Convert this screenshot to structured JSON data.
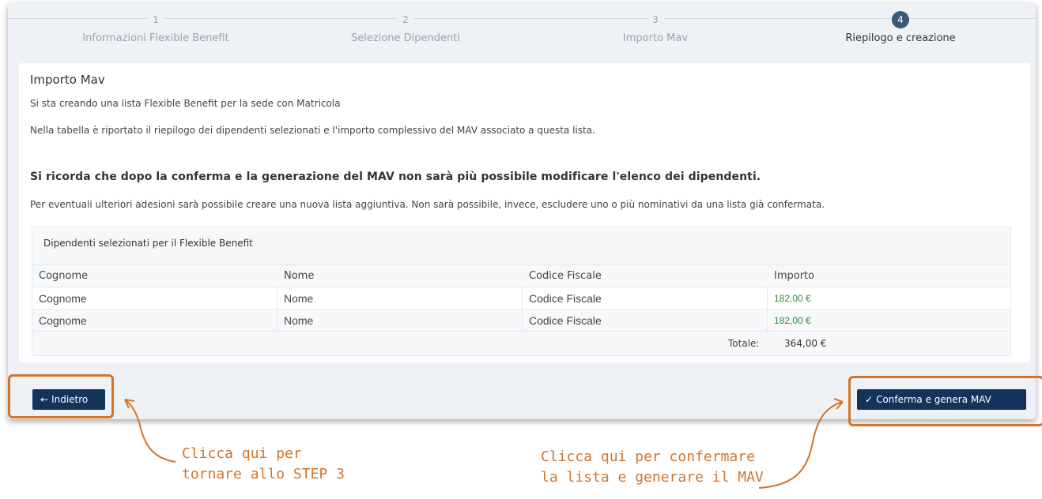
{
  "stepper": {
    "steps": [
      {
        "number": "1",
        "label": "Informazioni Flexible Benefit"
      },
      {
        "number": "2",
        "label": "Selezione Dipendenti"
      },
      {
        "number": "3",
        "label": "Importo Mav"
      },
      {
        "number": "4",
        "label": "Riepilogo e creazione"
      }
    ],
    "active_step": 4
  },
  "card": {
    "title": "Importo Mav",
    "intro": "Si sta creando una lista Flexible Benefit per la sede con Matricola",
    "description": "Nella tabella è riportato il riepilogo dei dipendenti selezionati e l'importo complessivo del MAV associato a questa lista.",
    "warning": "Si ricorda che dopo la conferma e la generazione del MAV non sarà più possibile modificare l'elenco dei dipendenti.",
    "note": "Per eventuali ulteriori adesioni sarà possibile creare una nuova lista aggiuntiva. Non sarà possibile, invece, escludere uno o più nominativi da una lista già confermata."
  },
  "table": {
    "caption": "Dipendenti selezionati per il Flexible Benefit",
    "columns": [
      "Cognome",
      "Nome",
      "Codice Fiscale",
      "Importo"
    ],
    "rows": [
      [
        "Cognome",
        "Nome",
        "Codice Fiscale",
        "182,00 €"
      ],
      [
        "Cognome",
        "Nome",
        "Codice Fiscale",
        "182,00 €"
      ]
    ],
    "total_label": "Totale:",
    "total_value": "364,00 €"
  },
  "actions": {
    "back_label": "Indietro",
    "confirm_label": "Conferma e genera MAV"
  },
  "annotations": {
    "back_note_line1": "Clicca qui per",
    "back_note_line2": "tornare allo STEP 3",
    "confirm_note_line1": "Clicca qui per confermare",
    "confirm_note_line2": "la lista e generare il MAV"
  },
  "colors": {
    "primary": "#14335a",
    "active_step": "#3c5878",
    "amount": "#2f8a3a",
    "annotation": "#d2742b"
  }
}
